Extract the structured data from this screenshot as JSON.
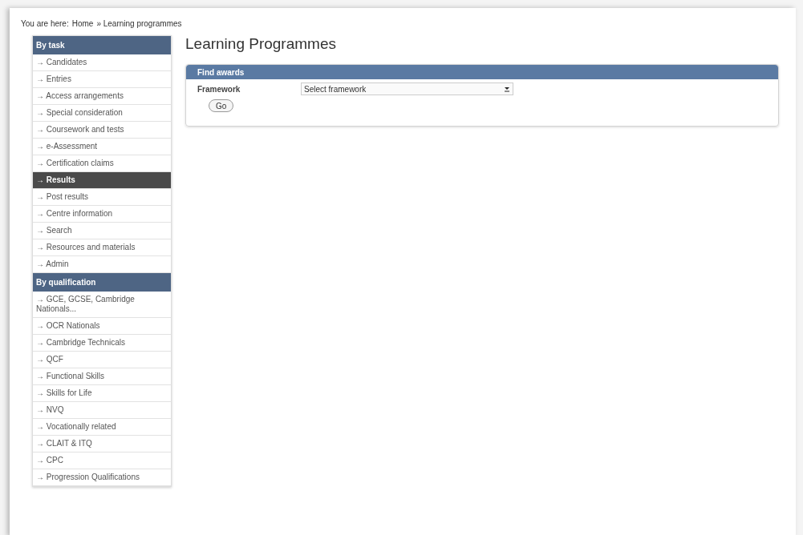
{
  "breadcrumb": {
    "prefix": "You are here:",
    "items": [
      "Home",
      "» Learning programmes"
    ]
  },
  "sidebar": {
    "sections": [
      {
        "title": "By task",
        "items": [
          {
            "label": "→ Candidates",
            "selected": false
          },
          {
            "label": "→ Entries",
            "selected": false
          },
          {
            "label": "→ Access arrangements",
            "selected": false
          },
          {
            "label": "→ Special consideration",
            "selected": false
          },
          {
            "label": "→ Coursework and tests",
            "selected": false
          },
          {
            "label": "→ e-Assessment",
            "selected": false
          },
          {
            "label": "→ Certification claims",
            "selected": false
          },
          {
            "label": "→ Results",
            "selected": true
          },
          {
            "label": "→ Post results",
            "selected": false
          },
          {
            "label": "→ Centre information",
            "selected": false
          },
          {
            "label": "→ Search",
            "selected": false
          },
          {
            "label": "→ Resources and materials",
            "selected": false
          },
          {
            "label": "→ Admin",
            "selected": false
          }
        ]
      },
      {
        "title": "By qualification",
        "items": [
          {
            "label": "→ GCE, GCSE, Cambridge Nationals...",
            "selected": false
          },
          {
            "label": "→ OCR Nationals",
            "selected": false
          },
          {
            "label": "→ Cambridge Technicals",
            "selected": false
          },
          {
            "label": "→ QCF",
            "selected": false
          },
          {
            "label": "→ Functional Skills",
            "selected": false
          },
          {
            "label": "→ Skills for Life",
            "selected": false
          },
          {
            "label": "→ NVQ",
            "selected": false
          },
          {
            "label": "→ Vocationally related",
            "selected": false
          },
          {
            "label": "→ CLAIT & ITQ",
            "selected": false
          },
          {
            "label": "→ CPC",
            "selected": false
          },
          {
            "label": "→ Progression Qualifications",
            "selected": false
          }
        ]
      }
    ]
  },
  "page_title": "Learning Programmes",
  "panel": {
    "title": "Find awards",
    "field_label": "Framework",
    "select_value": "Select framework",
    "button": "Go"
  }
}
